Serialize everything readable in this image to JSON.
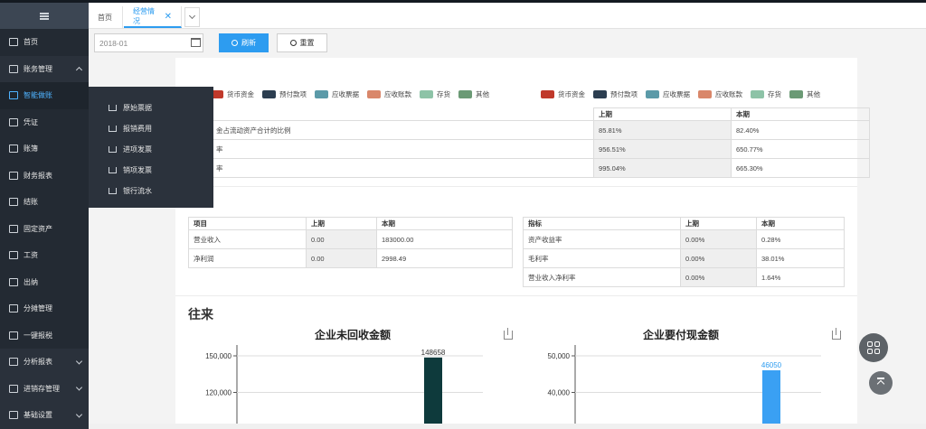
{
  "sidebar": {
    "items": [
      {
        "label": "首页",
        "icon": "home-icon"
      },
      {
        "label": "账务管理",
        "icon": "ledger-icon",
        "group": true,
        "expanded": true
      },
      {
        "label": "智能做账",
        "icon": "smart-accounting-icon",
        "active": true
      },
      {
        "label": "凭证",
        "icon": "voucher-icon"
      },
      {
        "label": "账簿",
        "icon": "book-icon"
      },
      {
        "label": "财务报表",
        "icon": "report-chart-icon"
      },
      {
        "label": "结账",
        "icon": "closing-icon"
      },
      {
        "label": "固定资产",
        "icon": "asset-icon"
      },
      {
        "label": "工资",
        "icon": "salary-icon"
      },
      {
        "label": "出纳",
        "icon": "cashier-icon"
      },
      {
        "label": "分摊管理",
        "icon": "allocation-icon"
      },
      {
        "label": "一键报税",
        "icon": "tax-icon"
      },
      {
        "label": "分析报表",
        "icon": "analysis-icon",
        "group": true
      },
      {
        "label": "进销存管理",
        "icon": "inventory-icon",
        "group": true
      },
      {
        "label": "基础设置",
        "icon": "settings-icon",
        "group": true
      }
    ]
  },
  "flyout": {
    "items": [
      "原始票据",
      "报销费用",
      "进项发票",
      "销项发票",
      "银行流水"
    ]
  },
  "tabs": {
    "home": "首页",
    "current": "经营情况",
    "close": "✕"
  },
  "toolbar": {
    "date_value": "2018-01",
    "refresh_label": "刷新",
    "reset_label": "重置"
  },
  "legend": {
    "items": [
      {
        "label": "货币资金",
        "color": "#c0392b"
      },
      {
        "label": "预付款项",
        "color": "#2c3e50"
      },
      {
        "label": "应收票据",
        "color": "#5b9aa8"
      },
      {
        "label": "应收账款",
        "color": "#d9876a"
      },
      {
        "label": "存货",
        "color": "#8dc3a7"
      },
      {
        "label": "其他",
        "color": "#6b9a75"
      }
    ]
  },
  "ratio_table": {
    "headers": [
      "上期",
      "本期"
    ],
    "rows": [
      {
        "label": "金占流动资产合计的比例",
        "prev": "85.81%",
        "cur": "82.40%"
      },
      {
        "label": "率",
        "prev": "956.51%",
        "cur": "650.77%"
      },
      {
        "label": "率",
        "prev": "995.04%",
        "cur": "665.30%"
      }
    ]
  },
  "profit_table": {
    "headers": [
      "项目",
      "上期",
      "本期"
    ],
    "rows": [
      {
        "item": "营业收入",
        "prev": "0.00",
        "cur": "183000.00"
      },
      {
        "item": "净利润",
        "prev": "0.00",
        "cur": "2998.49"
      }
    ]
  },
  "indicator_table": {
    "headers": [
      "指标",
      "上期",
      "本期"
    ],
    "rows": [
      {
        "item": "资产收益率",
        "prev": "0.00%",
        "cur": "0.28%"
      },
      {
        "item": "毛利率",
        "prev": "0.00%",
        "cur": "38.01%"
      },
      {
        "item": "营业收入净利率",
        "prev": "0.00%",
        "cur": "1.64%"
      }
    ]
  },
  "section_title": "往来",
  "chart_data": [
    {
      "type": "bar",
      "title": "企业未回收金额",
      "values": [
        148658
      ],
      "ylim": [
        90000,
        150000
      ],
      "yticks": [
        150000,
        120000
      ],
      "ytick_labels": [
        "150,000",
        "120,000"
      ],
      "bar_color": "#0e3a3c",
      "label_color": "#333333",
      "grid": true
    },
    {
      "type": "bar",
      "title": "企业要付现金额",
      "values": [
        46050
      ],
      "ylim": [
        30000,
        50000
      ],
      "yticks": [
        50000,
        40000
      ],
      "ytick_labels": [
        "50,000",
        "40,000"
      ],
      "bar_color": "#3aa0f3",
      "label_color": "#2d9cf0",
      "grid": true
    }
  ]
}
